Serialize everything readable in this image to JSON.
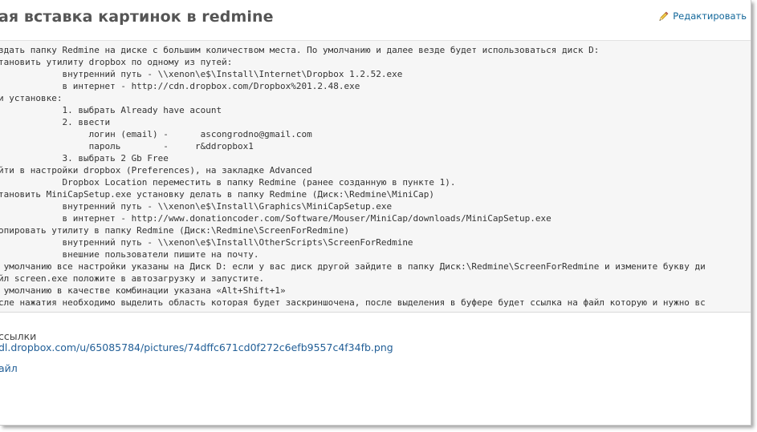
{
  "page": {
    "title": "ая вставка картинок в redmine",
    "edit_label": "Редактировать"
  },
  "code_block": {
    "lines": [
      "здать папку Redmine на диске с большим количеством места. По умолчанию и далее везде будет использоваться диск D:",
      "тановить утилиту dropbox по одному из путей:",
      "            внутренний путь - \\\\xenon\\e$\\Install\\Internet\\Dropbox 1.2.52.exe",
      "            в интернет - http://cdn.dropbox.com/Dropbox%201.2.48.exe",
      "и установке:",
      "            1. выбрать Already have acount",
      "            2. ввести",
      "                 логин (email) -      ascongrodno@gmail.com",
      "                 пароль        -     r&ddropbox1",
      "            3. выбрать 2 Gb Free",
      "йти в настройки dropbox (Preferences), на закладке Advanced",
      "            Dropbox Location переместить в папку Redmine (ранее созданную в пункте 1).",
      "тановить MiniCapSetup.exe установку делать в папку Redmine (Диск:\\Redmine\\MiniCap)",
      "            внутренний путь - \\\\xenon\\e$\\Install\\Graphics\\MiniCapSetup.exe",
      "            в интернет - http://www.donationcoder.com/Software/Mouser/MiniCap/downloads/MiniCapSetup.exe",
      "опировать утилиту в папку Redmine (Диск:\\Redmine\\ScreenForRedmine)",
      "            внутренний путь - \\\\xenon\\e$\\Install\\OtherScripts\\ScreenForRedmine",
      "            внешние пользователи пишите на почту.",
      " умолчанию все настройки указаны на Диск D: если у вас диск другой зайдите в папку Диск:\\Redmine\\ScreenForRedmine и измените букву ди",
      "йл screen.exe положите в автозагрузку и запустите.",
      " умолчанию в качестве комбинации указана «Alt+Shift+1»",
      "сле нажатия необходимо выделить область которая будет заскриншочена, после выделения в буфере будет ссылка на файл которую и нужно вс"
    ]
  },
  "links": {
    "label": "ссылки",
    "url": "dl.dropbox.com/u/65085784/pictures/74dffc671cd0f272c6efb9557c4f34fb.png",
    "file": "айл"
  }
}
